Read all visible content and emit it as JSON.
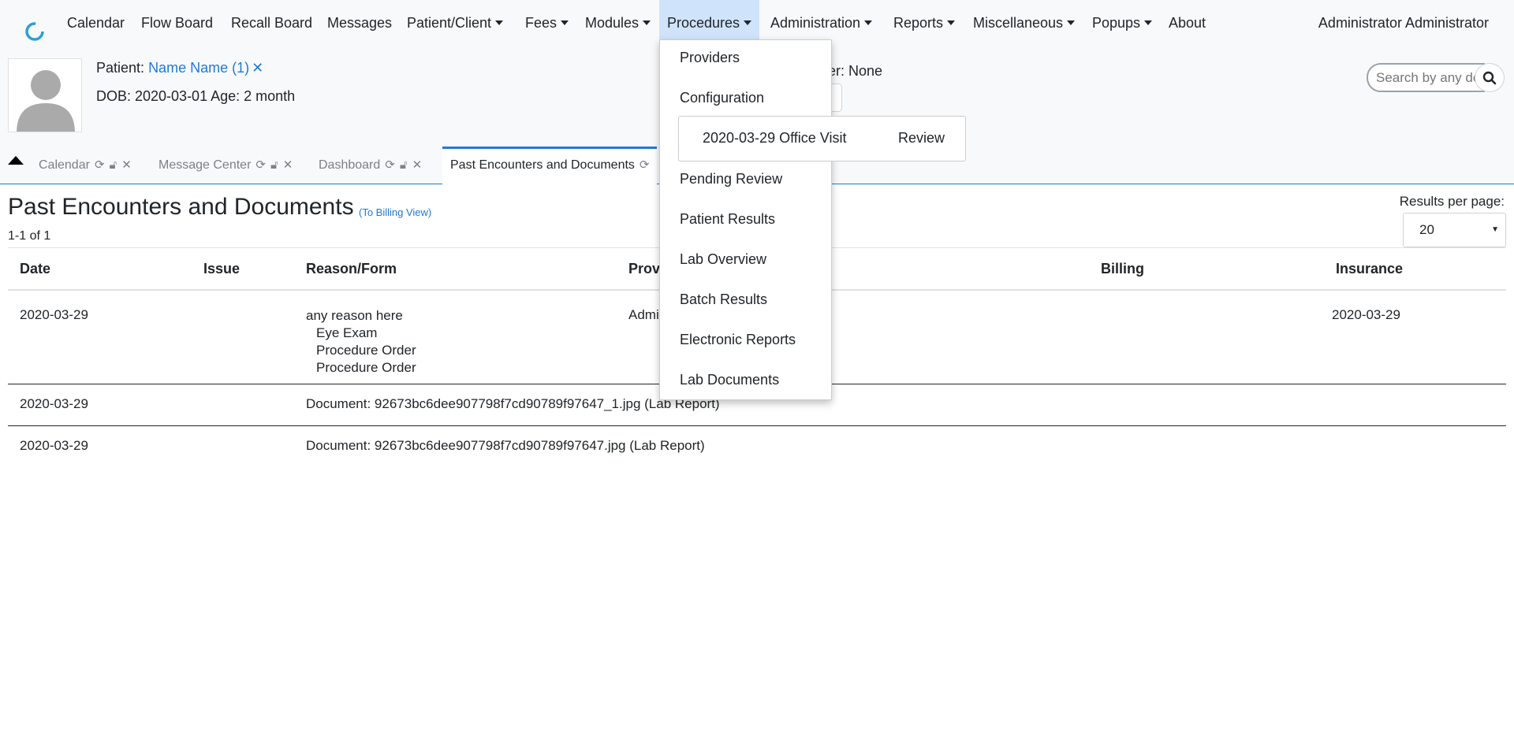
{
  "nav": {
    "items": [
      {
        "label": "Calendar",
        "caret": false
      },
      {
        "label": "Flow Board",
        "caret": false
      },
      {
        "label": "Recall Board",
        "caret": false
      },
      {
        "label": "Messages",
        "caret": false
      },
      {
        "label": "Patient/Client",
        "caret": true
      },
      {
        "label": "Fees",
        "caret": true
      },
      {
        "label": "Modules",
        "caret": true
      },
      {
        "label": "Procedures",
        "caret": true
      },
      {
        "label": "Administration",
        "caret": true
      },
      {
        "label": "Reports",
        "caret": true
      },
      {
        "label": "Miscellaneous",
        "caret": true
      },
      {
        "label": "Popups",
        "caret": true
      },
      {
        "label": "About",
        "caret": false
      }
    ],
    "user": "Administrator Administrator"
  },
  "patient": {
    "label": "Patient:",
    "name": "Name Name (1)",
    "dob": "DOB: 2020-03-01 Age: 2 month",
    "encounter_fragment": "er: None"
  },
  "search": {
    "placeholder": "Search by any demographics"
  },
  "tabs": [
    {
      "label": "Calendar"
    },
    {
      "label": "Message Center"
    },
    {
      "label": "Dashboard"
    },
    {
      "label": "Past Encounters and Documents"
    }
  ],
  "main": {
    "title": "Past Encounters and Documents",
    "billing_link": "(To Billing View)",
    "count": "1-1 of 1",
    "results_per_page_label": "Results per page:",
    "results_per_page_value": "20"
  },
  "table": {
    "headers": [
      "Date",
      "Issue",
      "Reason/Form",
      "Provi",
      "Billing",
      "Insurance"
    ],
    "rows": [
      {
        "date": "2020-03-29",
        "reason": "any reason here",
        "forms": [
          "Eye Exam",
          "Procedure Order",
          "Procedure Order"
        ],
        "provider": "Admi",
        "insurance": "2020-03-29"
      },
      {
        "date": "2020-03-29",
        "reason": "Document: 92673bc6dee907798f7cd90789f97647_1.jpg (Lab Report)"
      },
      {
        "date": "2020-03-29",
        "reason": "Document: 92673bc6dee907798f7cd90789f97647.jpg (Lab Report)"
      }
    ]
  },
  "dropdown": {
    "items": [
      "Providers",
      "Configuration",
      "Pending Review",
      "Patient Results",
      "Lab Overview",
      "Batch Results",
      "Electronic Reports",
      "Lab Documents"
    ],
    "submenu": {
      "label": "2020-03-29 Office Visit",
      "action": "Review"
    }
  },
  "colors": {
    "accent": "#1e7ad6",
    "active_nav": "#cfe3fb",
    "header_bg": "#f8f9fa"
  }
}
